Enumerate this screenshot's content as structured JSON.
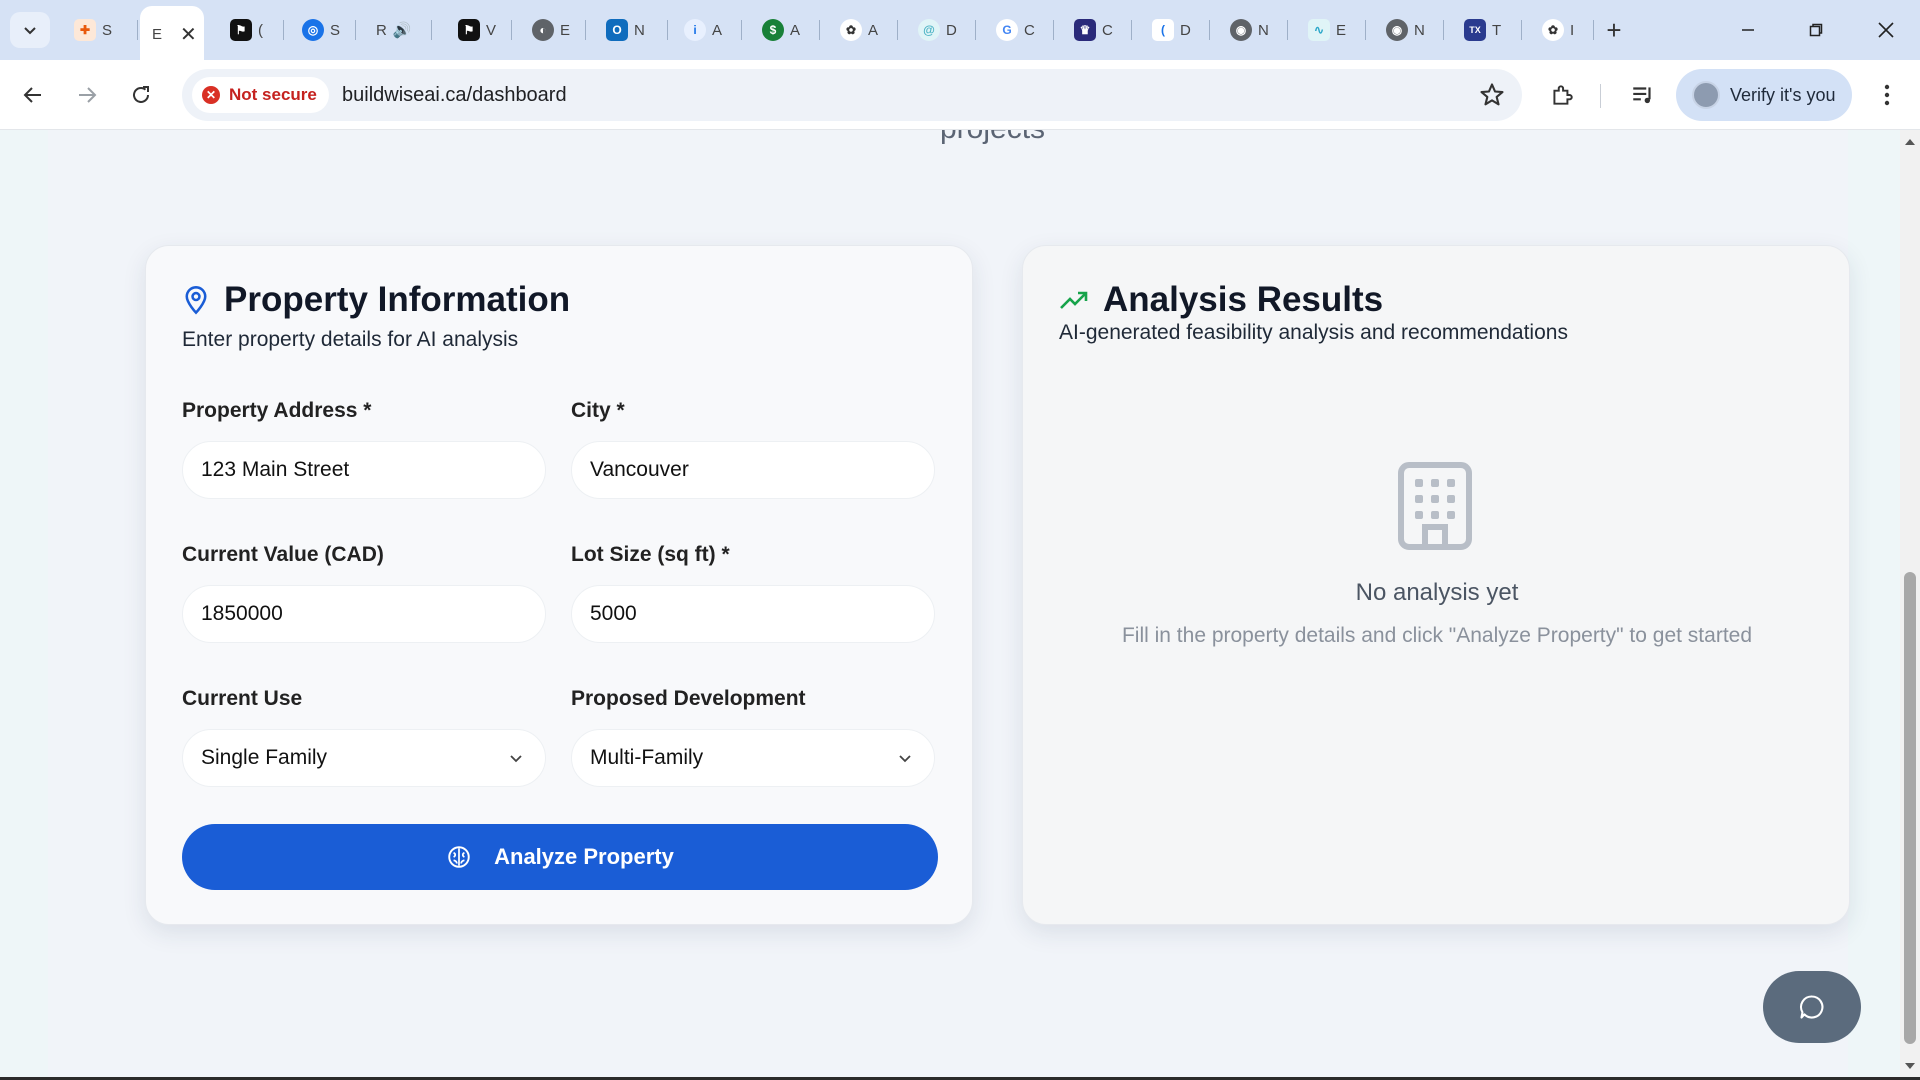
{
  "browser": {
    "tabs": [
      {
        "label": "S",
        "color": "#e8590c",
        "icon": "puzzle-icon"
      },
      {
        "label": "E",
        "active": true,
        "color": "#ffffff",
        "icon": "blank-icon"
      },
      {
        "label": "(",
        "color": "#111111",
        "icon": "flag-icon"
      },
      {
        "label": "S",
        "color": "#1a73e8",
        "icon": "target-icon"
      },
      {
        "label": "R",
        "color": "#ffffff",
        "icon": "audio-icon"
      },
      {
        "label": "V",
        "color": "#111111",
        "icon": "flag-icon"
      },
      {
        "label": "E",
        "color": "#3c4043",
        "icon": "globe-icon"
      },
      {
        "label": "N",
        "color": "#0f6cbd",
        "icon": "outlook-icon"
      },
      {
        "label": "A",
        "color": "#1a73e8",
        "icon": "info-icon"
      },
      {
        "label": "A",
        "color": "#188038",
        "icon": "dollar-icon"
      },
      {
        "label": "A",
        "color": "#3c4043",
        "icon": "openai-icon"
      },
      {
        "label": "D",
        "color": "#4bb3c4",
        "icon": "spiral-icon"
      },
      {
        "label": "C",
        "color": "#ffffff",
        "icon": "google-icon"
      },
      {
        "label": "C",
        "color": "#2a2a7a",
        "icon": "crest-icon"
      },
      {
        "label": "D",
        "color": "#1a73e8",
        "icon": "bracket-icon"
      },
      {
        "label": "N",
        "color": "#3c4043",
        "icon": "chrome-icon"
      },
      {
        "label": "E",
        "color": "#2aa7c9",
        "icon": "wave-icon"
      },
      {
        "label": "N",
        "color": "#3c4043",
        "icon": "chrome-icon"
      },
      {
        "label": "T",
        "color": "#2a3b8f",
        "icon": "news-icon"
      },
      {
        "label": "I",
        "color": "#3c4043",
        "icon": "openai-icon"
      }
    ],
    "close_tab": "✕",
    "new_tab": "+",
    "not_secure": "Not secure",
    "url": "buildwiseai.ca/dashboard",
    "profile_label": "Verify it's you"
  },
  "page": {
    "heading_fragment": "projects",
    "property_card": {
      "title": "Property Information",
      "subtitle": "Enter property details for AI analysis",
      "fields": {
        "address": {
          "label": "Property Address *",
          "value": "123 Main Street"
        },
        "city": {
          "label": "City *",
          "value": "Vancouver"
        },
        "current_value": {
          "label": "Current Value (CAD)",
          "value": "1850000"
        },
        "lot_size": {
          "label": "Lot Size (sq ft) *",
          "value": "5000"
        },
        "current_use": {
          "label": "Current Use",
          "value": "Single Family"
        },
        "proposed_development": {
          "label": "Proposed Development",
          "value": "Multi-Family"
        }
      },
      "button_label": "Analyze Property"
    },
    "results_card": {
      "title": "Analysis Results",
      "subtitle": "AI-generated feasibility analysis and recommendations",
      "empty_title": "No analysis yet",
      "empty_text": "Fill in the property details and click \"Analyze Property\" to get started"
    }
  },
  "colors": {
    "primary": "#1a5dd6",
    "accent_green": "#16a34a",
    "pin_blue": "#1a5dd6",
    "not_secure_red": "#d93025"
  }
}
